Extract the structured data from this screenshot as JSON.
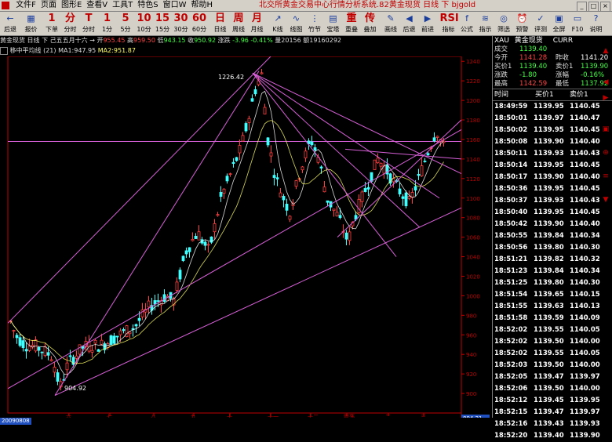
{
  "window": {
    "title": "北交所黄金交易中心行情分析系统.82黄金现货 日线 下 bjgold"
  },
  "menu": [
    "文件F",
    "页面",
    "图形E",
    "查看V",
    "工具T",
    "特色S",
    "窗口W",
    "帮助H"
  ],
  "toolbar": [
    {
      "glyph": "←",
      "label": "后退",
      "kind": "ico"
    },
    {
      "glyph": "▦",
      "label": "报价",
      "kind": "ico"
    },
    {
      "glyph": "1",
      "label": "下单",
      "kind": "big"
    },
    {
      "glyph": "分",
      "label": "分时",
      "kind": "big"
    },
    {
      "glyph": "T",
      "label": "分时",
      "kind": "big"
    },
    {
      "glyph": "1",
      "label": "1分",
      "kind": "big"
    },
    {
      "glyph": "5",
      "label": "5分",
      "kind": "big"
    },
    {
      "glyph": "10",
      "label": "10分",
      "kind": "big"
    },
    {
      "glyph": "15",
      "label": "15分",
      "kind": "big"
    },
    {
      "glyph": "30",
      "label": "30分",
      "kind": "big"
    },
    {
      "glyph": "60",
      "label": "60分",
      "kind": "big"
    },
    {
      "glyph": "日",
      "label": "日线",
      "kind": "big"
    },
    {
      "glyph": "周",
      "label": "周线",
      "kind": "big"
    },
    {
      "glyph": "月",
      "label": "月线",
      "kind": "big"
    },
    {
      "glyph": "↗",
      "label": "K线",
      "kind": "ico"
    },
    {
      "glyph": "∿",
      "label": "线图",
      "kind": "ico"
    },
    {
      "glyph": "⋮",
      "label": "竹节",
      "kind": "ico"
    },
    {
      "glyph": "▤",
      "label": "宝塔",
      "kind": "ico"
    },
    {
      "glyph": "重",
      "label": "重叠",
      "kind": "big"
    },
    {
      "glyph": "传",
      "label": "叠加",
      "kind": "big"
    },
    {
      "glyph": "✎",
      "label": "画线",
      "kind": "ico"
    },
    {
      "glyph": "◀",
      "label": "后退",
      "kind": "ico"
    },
    {
      "glyph": "▶",
      "label": "前进",
      "kind": "ico"
    },
    {
      "glyph": "RSI",
      "label": "指标",
      "kind": "big"
    },
    {
      "glyph": "f",
      "label": "公式",
      "kind": "ico"
    },
    {
      "glyph": "≋",
      "label": "指示",
      "kind": "ico"
    },
    {
      "glyph": "◎",
      "label": "筛选",
      "kind": "ico"
    },
    {
      "glyph": "⏰",
      "label": "预警",
      "kind": "ico"
    },
    {
      "glyph": "✓",
      "label": "评测",
      "kind": "ico"
    },
    {
      "glyph": "▣",
      "label": "全屏",
      "kind": "ico"
    },
    {
      "glyph": "▭",
      "label": "F10",
      "kind": "ico"
    },
    {
      "glyph": "?",
      "label": "说明",
      "kind": "ico"
    }
  ],
  "infobar": {
    "symbol": "黄金现货",
    "period": "日线",
    "direction": "下",
    "date": "己五五月十六",
    "arrow": "→",
    "open_label": "开",
    "open": "955.45",
    "high_label": "高",
    "high": "959.50",
    "low_label": "低",
    "low": "943.15",
    "close_label": "收",
    "close": "950.92",
    "change_label": "涨跌",
    "change": "-3.96",
    "pct": "-0.41%",
    "vol_label": "量",
    "vol": "20156",
    "amt_label": "额",
    "amt": "19160292"
  },
  "mabar": {
    "name": "移中平均线",
    "param": "(21)",
    "ma1": "MA1:947.95",
    "ma2": "MA2:951.87"
  },
  "chart_data": {
    "type": "candlestick",
    "ylim": [
      880,
      1245
    ],
    "yticks": [
      900,
      920,
      940,
      960,
      980,
      1000,
      1020,
      1040,
      1060,
      1080,
      1100,
      1120,
      1140,
      1160,
      1180,
      1200,
      1220,
      1240
    ],
    "ytick_labels": [
      "900",
      "920",
      "940",
      "960",
      "980",
      "1000",
      "1020",
      "1040",
      "1060",
      "1080",
      "1100",
      "1120",
      "1140",
      "1160",
      "1180",
      "1200",
      "1220",
      "1240"
    ],
    "xtick_labels": [
      "六",
      "七",
      "八",
      "九",
      "十",
      "十一",
      "十二",
      "震荡",
      "二",
      "三"
    ],
    "annotations": [
      {
        "text": "1226.42",
        "value": 1226.42
      },
      {
        "text": "904.92",
        "value": 904.92
      }
    ],
    "current_price_label": "894.21",
    "horizontal_level": 1158,
    "ma_series": [
      "MA1",
      "MA2"
    ]
  },
  "status": {
    "date": "20090808"
  },
  "quote": {
    "header_symbol": "XAU",
    "header_name": "黄金现货",
    "header_code": "CURR",
    "rows": [
      {
        "l1": "成交",
        "v1": "1139.40",
        "l2": "",
        "v2": "",
        "c1": "#40ff40",
        "c2": "#ffffff"
      },
      {
        "l1": "今开",
        "v1": "1141.28",
        "l2": "昨收",
        "v2": "1141.20",
        "c1": "#ff4040",
        "c2": "#ffffff"
      },
      {
        "l1": "买价1",
        "v1": "1139.40",
        "l2": "卖价1",
        "v2": "1139.90",
        "c1": "#40ff40",
        "c2": "#40ff40"
      },
      {
        "l1": "涨跌",
        "v1": "-1.80",
        "l2": "涨幅",
        "v2": "-0.16%",
        "c1": "#40ff40",
        "c2": "#40ff40"
      },
      {
        "l1": "最高",
        "v1": "1142.59",
        "l2": "最低",
        "v2": "1137.92",
        "c1": "#ff4040",
        "c2": "#40ff40"
      }
    ]
  },
  "ticks": {
    "col_time": "时间",
    "col_buy": "买价1",
    "col_sell": "卖价1",
    "rows": [
      {
        "t": "18:49:59",
        "b": "1139.95",
        "s": "1140.45"
      },
      {
        "t": "18:50:01",
        "b": "1139.97",
        "s": "1140.47"
      },
      {
        "t": "18:50:02",
        "b": "1139.95",
        "s": "1140.45"
      },
      {
        "t": "18:50:08",
        "b": "1139.90",
        "s": "1140.40"
      },
      {
        "t": "18:50:11",
        "b": "1139.93",
        "s": "1140.43"
      },
      {
        "t": "18:50:14",
        "b": "1139.95",
        "s": "1140.45"
      },
      {
        "t": "18:50:17",
        "b": "1139.90",
        "s": "1140.40"
      },
      {
        "t": "18:50:36",
        "b": "1139.95",
        "s": "1140.45"
      },
      {
        "t": "18:50:37",
        "b": "1139.93",
        "s": "1140.43"
      },
      {
        "t": "18:50:40",
        "b": "1139.95",
        "s": "1140.45"
      },
      {
        "t": "18:50:42",
        "b": "1139.90",
        "s": "1140.40"
      },
      {
        "t": "18:50:55",
        "b": "1139.84",
        "s": "1140.34"
      },
      {
        "t": "18:50:56",
        "b": "1139.80",
        "s": "1140.30"
      },
      {
        "t": "18:51:21",
        "b": "1139.82",
        "s": "1140.32"
      },
      {
        "t": "18:51:23",
        "b": "1139.84",
        "s": "1140.34"
      },
      {
        "t": "18:51:25",
        "b": "1139.80",
        "s": "1140.30"
      },
      {
        "t": "18:51:54",
        "b": "1139.65",
        "s": "1140.15"
      },
      {
        "t": "18:51:55",
        "b": "1139.63",
        "s": "1140.13"
      },
      {
        "t": "18:51:58",
        "b": "1139.59",
        "s": "1140.09"
      },
      {
        "t": "18:52:02",
        "b": "1139.55",
        "s": "1140.05"
      },
      {
        "t": "18:52:02",
        "b": "1139.50",
        "s": "1140.00"
      },
      {
        "t": "18:52:02",
        "b": "1139.55",
        "s": "1140.05"
      },
      {
        "t": "18:52:03",
        "b": "1139.50",
        "s": "1140.00"
      },
      {
        "t": "18:52:05",
        "b": "1139.47",
        "s": "1139.97"
      },
      {
        "t": "18:52:06",
        "b": "1139.50",
        "s": "1140.00"
      },
      {
        "t": "18:52:12",
        "b": "1139.45",
        "s": "1139.95"
      },
      {
        "t": "18:52:15",
        "b": "1139.47",
        "s": "1139.97"
      },
      {
        "t": "18:52:16",
        "b": "1139.43",
        "s": "1139.93"
      },
      {
        "t": "18:52:20",
        "b": "1139.40",
        "s": "1139.90"
      }
    ]
  },
  "colors": {
    "up": "#ff4040",
    "down": "#40ffff",
    "trendline": "#d860d8",
    "ma1": "#ffffff",
    "ma2": "#ffff60",
    "axis": "#c00000"
  }
}
